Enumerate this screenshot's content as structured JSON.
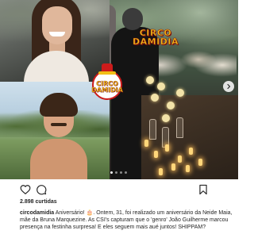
{
  "post": {
    "likes_text": "2.898 curtidas",
    "caption": {
      "username": "circodamidia",
      "text_before_emoji": " Aniversário! ",
      "emoji": "🎂",
      "text_after_emoji": ". Ontem, 31, foi realizado um aniversário da Neide Maia, mãe da Bruna Marquezine. As CSI's capturam que o 'genro' João Guilherme marcou presença na festinha surpresa! E eles seguem mais aué juntos! SHIPPAM?"
    }
  },
  "media": {
    "logo_text_line1": "CIRCO",
    "logo_text_line2": "DAMIDIA",
    "badge_line1": "CIRCO",
    "badge_line2": "DAMIDIA",
    "carousel_dot_count": 4,
    "carousel_active_index": 0
  },
  "actions": {
    "like_icon": "heart-icon",
    "comment_icon": "comment-icon",
    "save_icon": "bookmark-icon"
  },
  "colors": {
    "logo_yellow": "#f2be16",
    "logo_red": "#cc1b1b",
    "text": "#262626"
  }
}
